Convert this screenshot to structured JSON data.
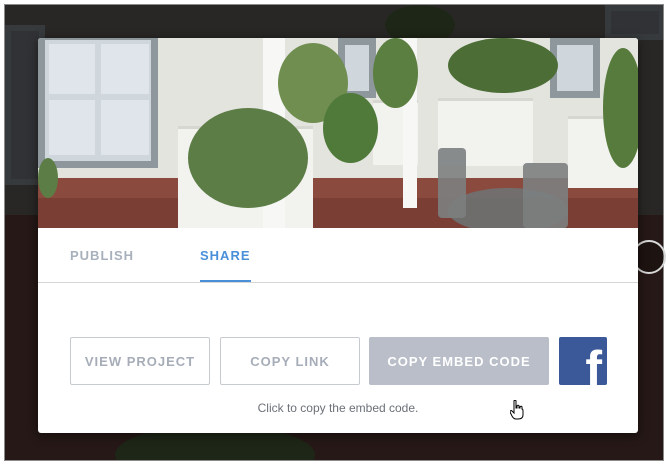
{
  "tabs": [
    {
      "label": "PUBLISH",
      "active": false
    },
    {
      "label": "SHARE",
      "active": true
    }
  ],
  "buttons": {
    "view_project": "VIEW PROJECT",
    "copy_link": "COPY LINK",
    "copy_embed": "COPY EMBED CODE"
  },
  "social": {
    "facebook_glyph": "f",
    "icon": "facebook-icon"
  },
  "hint": "Click to copy the embed code.",
  "colors": {
    "accent": "#4a90d9",
    "embed_button_active": "#b9bec9",
    "facebook": "#3b5998",
    "muted_text": "#a6adb8"
  }
}
